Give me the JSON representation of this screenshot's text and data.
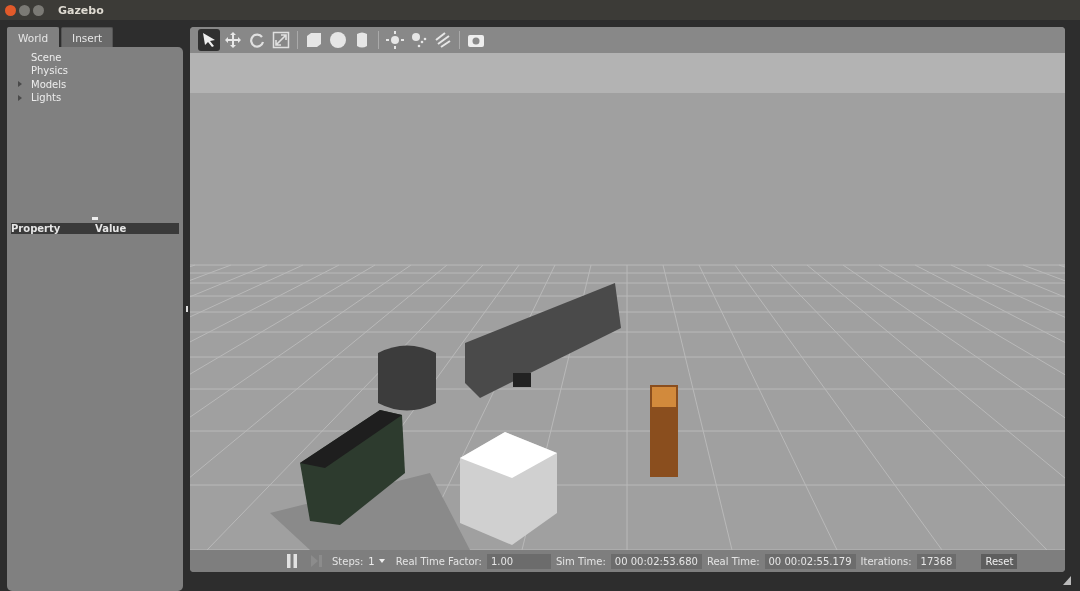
{
  "window": {
    "title": "Gazebo"
  },
  "tabs": [
    {
      "label": "World",
      "selected": true
    },
    {
      "label": "Insert",
      "selected": false
    }
  ],
  "tree": [
    {
      "label": "Scene",
      "expandable": false
    },
    {
      "label": "Physics",
      "expandable": false
    },
    {
      "label": "Models",
      "expandable": true
    },
    {
      "label": "Lights",
      "expandable": true
    }
  ],
  "property_table": {
    "columns": [
      "Property",
      "Value"
    ]
  },
  "toolbar": {
    "groups": [
      [
        {
          "kind": "select",
          "selected": true
        },
        {
          "kind": "translate",
          "selected": false
        },
        {
          "kind": "rotate",
          "selected": false
        },
        {
          "kind": "scale",
          "selected": false
        }
      ],
      [
        {
          "kind": "box",
          "selected": false
        },
        {
          "kind": "sphere",
          "selected": false
        },
        {
          "kind": "cylinder",
          "selected": false
        }
      ],
      [
        {
          "kind": "point-light",
          "selected": false
        },
        {
          "kind": "spot-light",
          "selected": false
        },
        {
          "kind": "directional-light",
          "selected": false
        }
      ],
      [
        {
          "kind": "screenshot",
          "selected": false
        }
      ]
    ]
  },
  "status_bar": {
    "paused": false,
    "steps_label": "Steps:",
    "steps_value": "1",
    "fields": [
      {
        "label": "Real Time Factor:",
        "value": "1.00"
      },
      {
        "label": "Sim Time:",
        "value": "00 00:02:53.680"
      },
      {
        "label": "Real Time:",
        "value": "00 00:02:55.179"
      },
      {
        "label": "Iterations:",
        "value": "17368"
      }
    ],
    "reset": "Reset"
  }
}
